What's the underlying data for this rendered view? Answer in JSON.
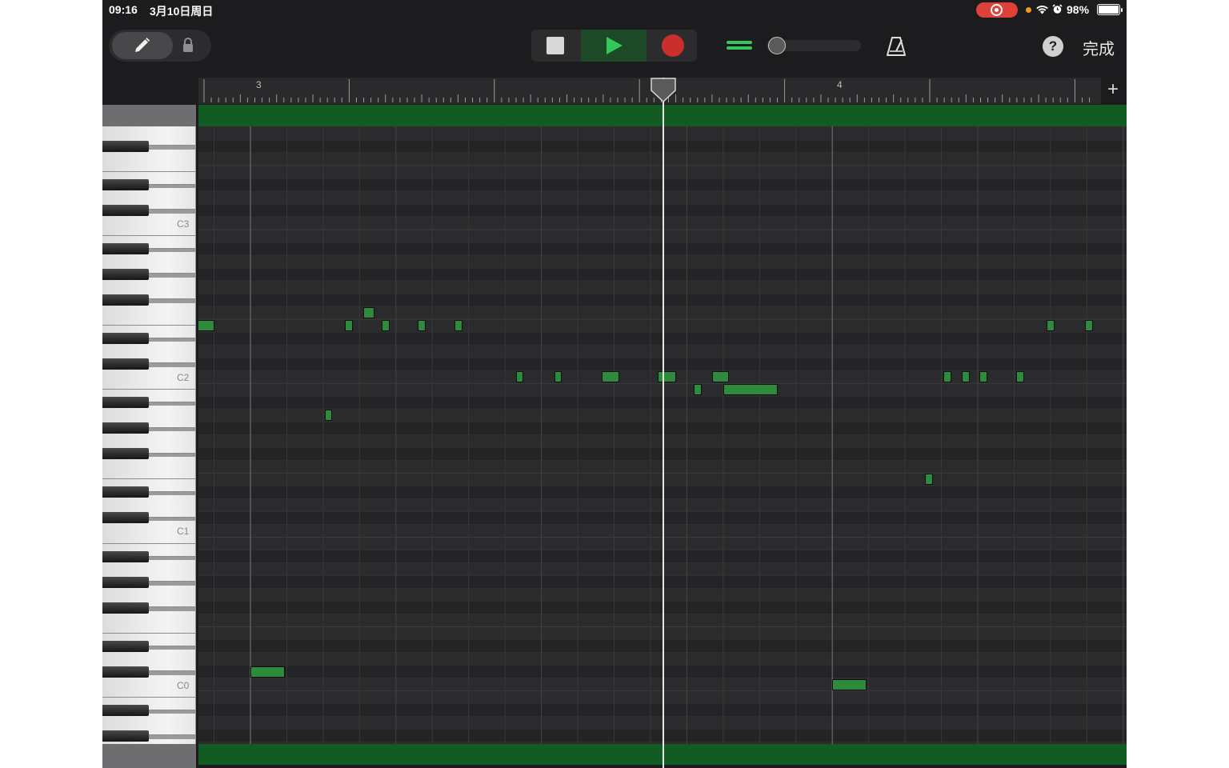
{
  "status_bar": {
    "time": "09:16",
    "date": "3月10日周日",
    "battery": "98%"
  },
  "toolbar": {
    "done_label": "完成",
    "help_label": "?"
  },
  "ruler": {
    "bars": [
      {
        "label": "3"
      },
      {
        "label": "4"
      }
    ],
    "add_label": "+"
  },
  "keyboard": {
    "octave_labels": [
      "C3",
      "C2",
      "C1",
      "C0"
    ]
  },
  "colors": {
    "accent_green": "#34c759",
    "region_green": "#135c21",
    "note_green": "#2e8b3e",
    "record_red": "#c9302c"
  },
  "piano_roll": {
    "notes": [
      {
        "bar": 3.0,
        "duration_16ths": 1,
        "row": "E2"
      },
      {
        "bar": 3.0,
        "duration_16ths": 2,
        "row": "B-1"
      },
      {
        "bar": 3.5,
        "duration_16ths": 1,
        "row": "C#2"
      },
      {
        "bar": 4.0,
        "duration_16ths": 2,
        "row": "A-1"
      }
    ]
  }
}
